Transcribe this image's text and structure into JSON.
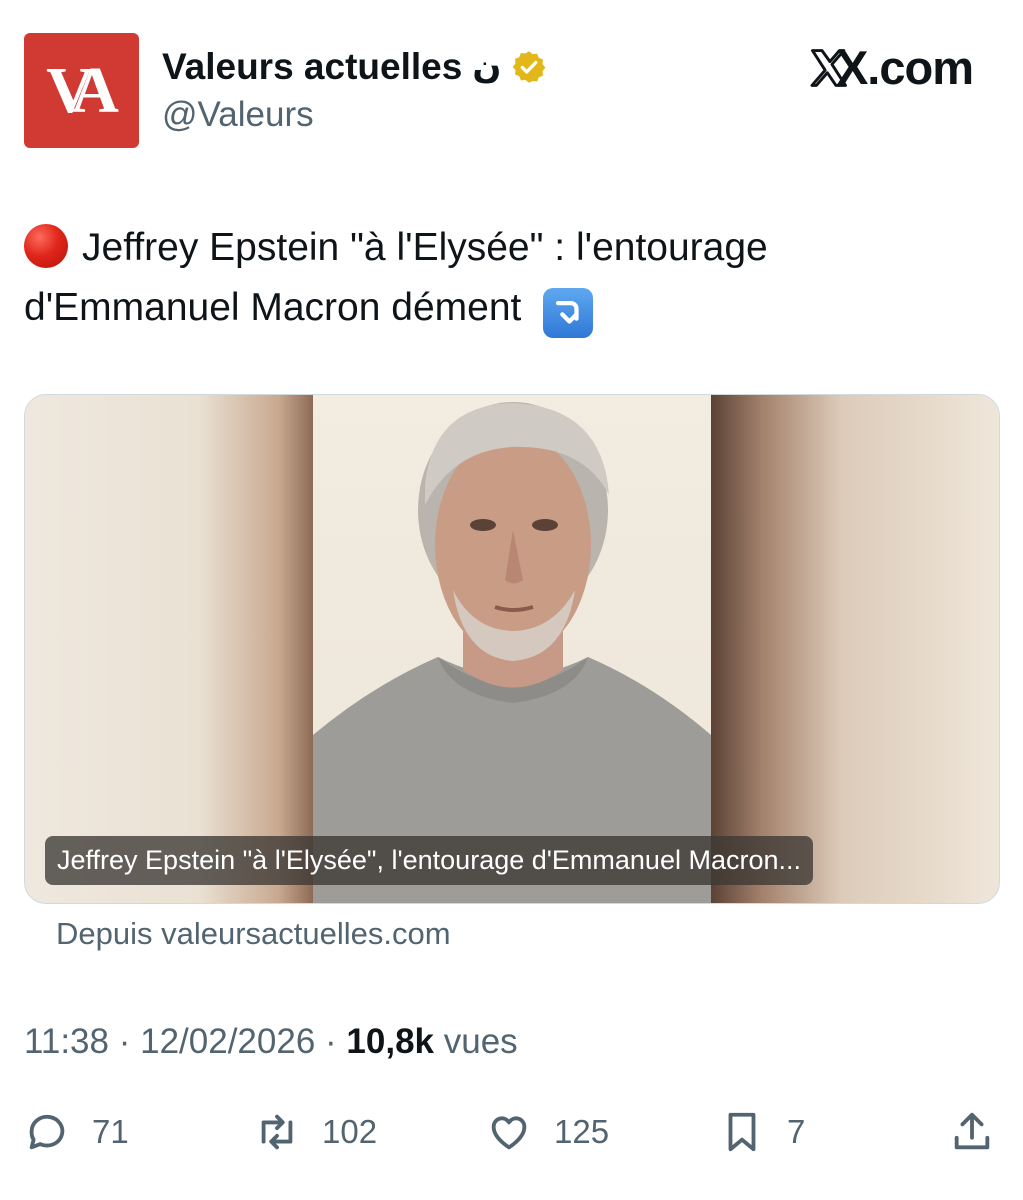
{
  "account": {
    "avatar_text": "VA",
    "name": "Valeurs actuelles",
    "name_extra": "ن",
    "handle": "@Valeurs",
    "verified_color": "#e2b719",
    "brand_color": "#d13a32"
  },
  "watermark": "X.com",
  "tweet": {
    "text_line1": "Jeffrey Epstein \"à l'Elysée\" : l'entourage",
    "text_line2": "d'Emmanuel Macron dément",
    "leading_emoji": "red-circle",
    "trailing_emoji": "arrow-down-right-box"
  },
  "card": {
    "caption": "Jeffrey Epstein \"à l'Elysée\", l'entourage d'Emmanuel Macron...",
    "source": "Depuis valeursactuelles.com"
  },
  "meta": {
    "time": "11:38",
    "separator": "·",
    "date": "12/02/2026",
    "views_count": "10,8k",
    "views_label": "vues"
  },
  "actions": {
    "replies": "71",
    "reposts": "102",
    "likes": "125",
    "bookmarks": "7"
  }
}
